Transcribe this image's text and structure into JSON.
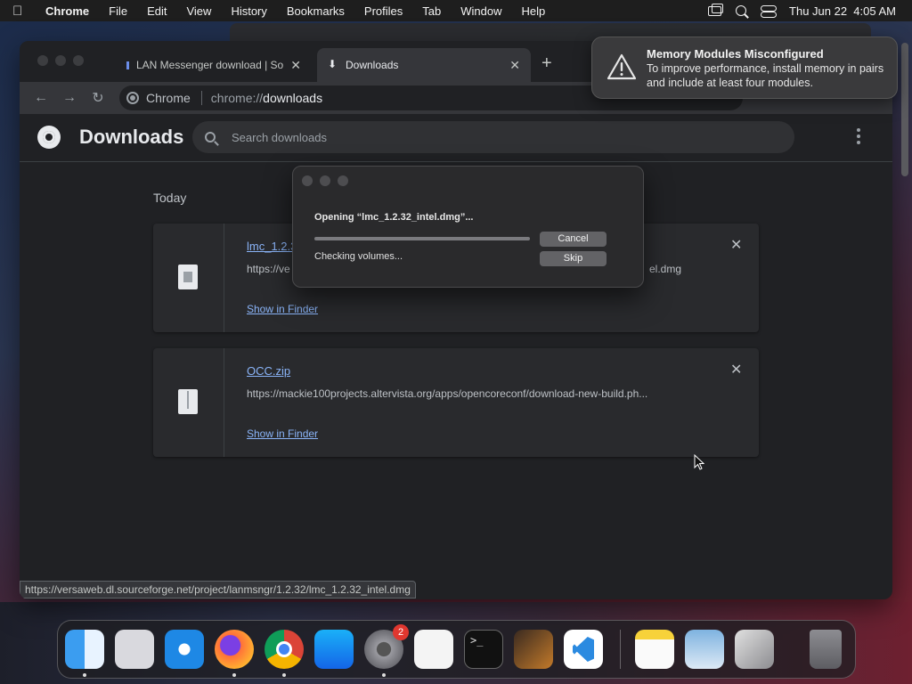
{
  "menubar": {
    "app_name": "Chrome",
    "items": [
      "File",
      "Edit",
      "View",
      "History",
      "Bookmarks",
      "Profiles",
      "Tab",
      "Window",
      "Help"
    ],
    "datetime": "Thu Jun 22  4:05 AM"
  },
  "browser": {
    "tabs": [
      {
        "label": "LAN Messenger download | So"
      },
      {
        "label": "Downloads"
      }
    ],
    "omnibox": {
      "chip": "Chrome",
      "scheme": "chrome://",
      "host": "downloads"
    }
  },
  "downloads_page": {
    "title": "Downloads",
    "search_placeholder": "Search downloads",
    "section_label": "Today",
    "items": [
      {
        "file_name": "lmc_1.2.32_intel.dmg",
        "file_name_visible": "lmc_1.2.3",
        "url_left": "https://ve",
        "url_right": "el.dmg",
        "action": "Show in Finder"
      },
      {
        "file_name": "OCC.zip",
        "url": "https://mackie100projects.altervista.org/apps/opencoreconf/download-new-build.ph...",
        "action": "Show in Finder"
      }
    ],
    "status_url": "https://versaweb.dl.sourceforge.net/project/lanmsngr/1.2.32/lmc_1.2.32_intel.dmg"
  },
  "dialog": {
    "title": "Opening “lmc_1.2.32_intel.dmg”...",
    "status": "Checking volumes...",
    "progress": 1.0,
    "cancel_label": "Cancel",
    "skip_label": "Skip"
  },
  "notification": {
    "title": "Memory Modules Misconfigured",
    "body": "To improve performance, install memory in pairs and include at least four modules."
  },
  "dock": {
    "apps": [
      "Finder",
      "Launchpad",
      "Safari",
      "Firefox",
      "Chrome",
      "App Store",
      "System Settings",
      "TextEdit",
      "Terminal",
      "GarageBand",
      "Visual Studio Code",
      "Notes",
      "Preview",
      "Boot Camp Assistant",
      "Trash"
    ],
    "settings_badge": "2"
  },
  "colors": {
    "link": "#8ab4f8",
    "page_bg": "#202124",
    "badge": "#e0372f"
  }
}
